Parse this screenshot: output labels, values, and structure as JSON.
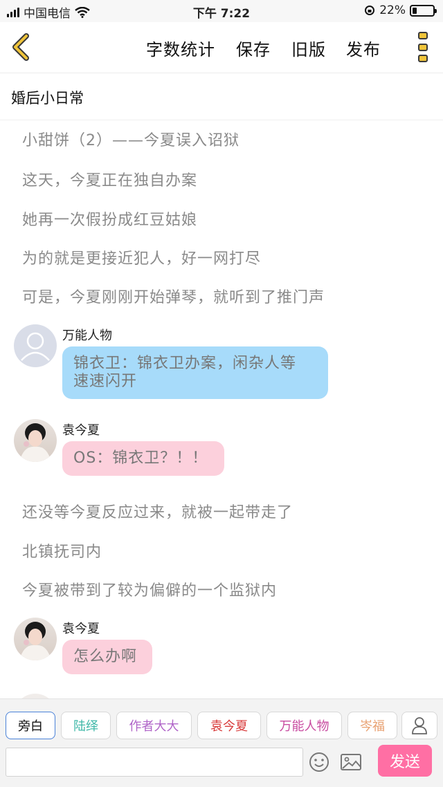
{
  "status_bar": {
    "carrier": "中国电信",
    "time": "下午 7:22",
    "battery_percent": "22%",
    "battery_level": 0.22
  },
  "toolbar": {
    "word_count": "字数统计",
    "save": "保存",
    "old_version": "旧版",
    "publish": "发布",
    "accent_color": "#f0c43a"
  },
  "document": {
    "title": "婚后小日常"
  },
  "content": {
    "narration": [
      "小甜饼（2）——今夏误入诏狱",
      "这天，今夏正在独自办案",
      "她再一次假扮成红豆姑娘",
      "为的就是更接近犯人，好一网打尽",
      "可是，今夏刚刚开始弹琴，就听到了推门声",
      "还没等今夏反应过来，就被一起带走了",
      "北镇抚司内",
      "今夏被带到了较为偏僻的一个监狱内"
    ],
    "messages": [
      {
        "sender": "万能人物",
        "lines": [
          "锦衣卫：锦衣卫办案，闲杂人等",
          "速速闪开"
        ],
        "color": "#a7dbfa"
      },
      {
        "sender": "袁今夏",
        "lines": [
          "OS：锦衣卫？！！"
        ],
        "color": "#fcd0dc"
      },
      {
        "sender": "袁今夏",
        "lines": [
          "怎么办啊"
        ],
        "color": "#fcd0dc"
      }
    ]
  },
  "roles": [
    {
      "label": "旁白",
      "color": "#111111"
    },
    {
      "label": "陆绎",
      "color": "#3fb8a8"
    },
    {
      "label": "作者大大",
      "color": "#b064c8"
    },
    {
      "label": "袁今夏",
      "color": "#d83a3a"
    },
    {
      "label": "万能人物",
      "color": "#c84aa0"
    },
    {
      "label": "岑福",
      "color": "#e8a070"
    }
  ],
  "composer": {
    "input_value": "",
    "send_label": "发送",
    "send_color": "#ff6fa4"
  }
}
